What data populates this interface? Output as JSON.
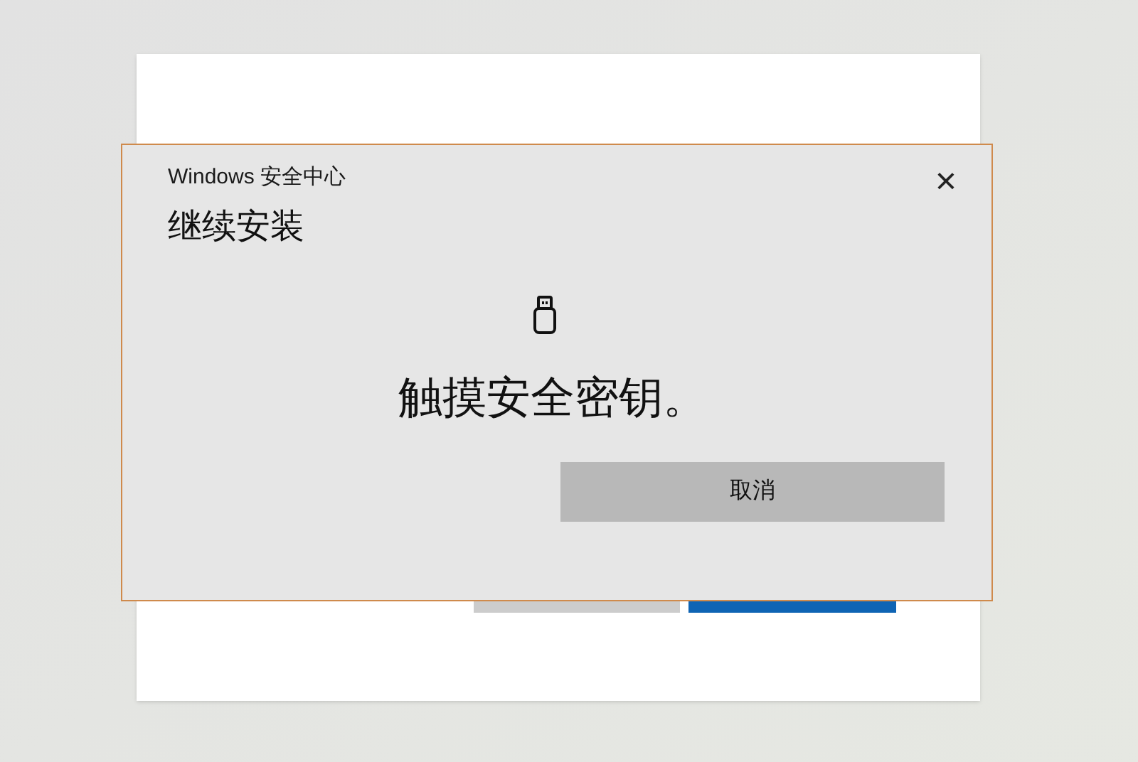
{
  "dialog": {
    "title": "Windows 安全中心",
    "close": "×",
    "heading": "继续安装",
    "message": "触摸安全密钥。",
    "buttons": [
      "取消"
    ]
  },
  "background_window": {
    "buttons": [
      {
        "kind": "secondary"
      },
      {
        "kind": "primary"
      }
    ]
  }
}
